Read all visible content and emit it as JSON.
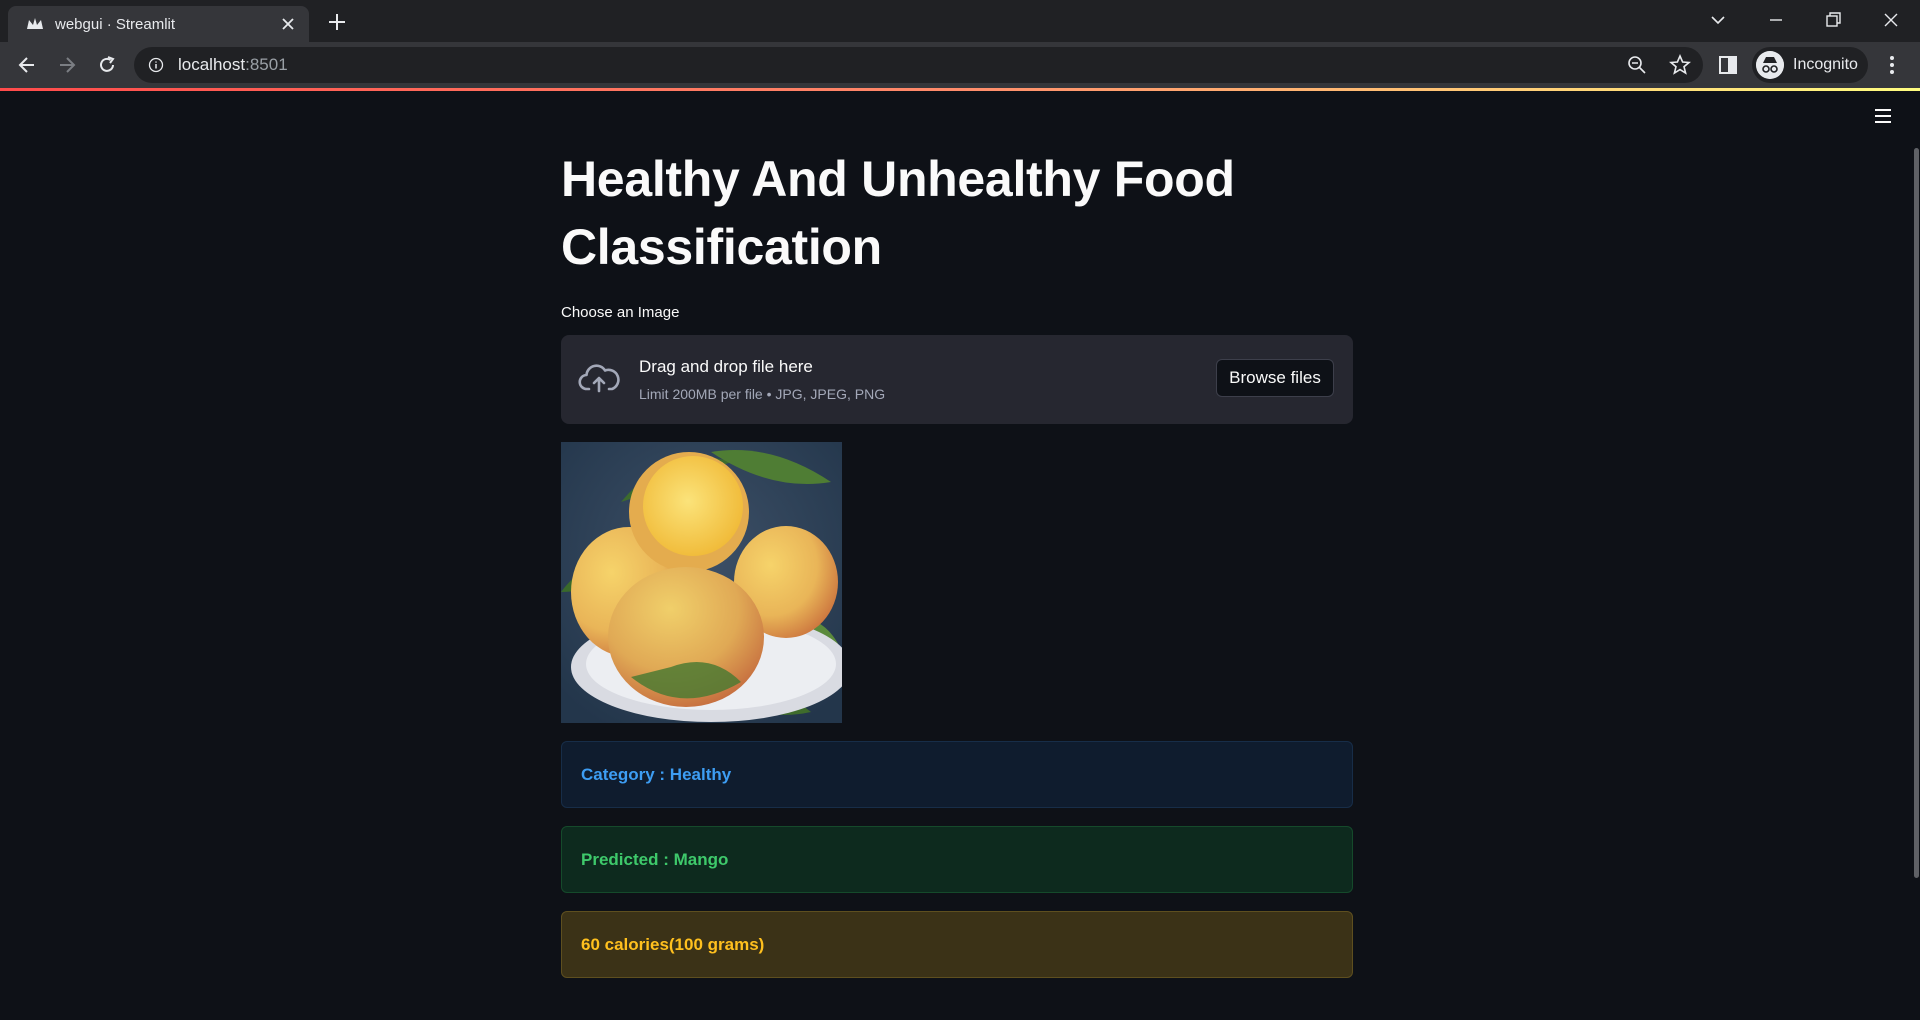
{
  "browser": {
    "tab": {
      "title": "webgui · Streamlit",
      "favicon": "streamlit-crown-icon"
    },
    "url_host": "localhost",
    "url_port": ":8501",
    "profile_label": "Incognito"
  },
  "page": {
    "title": "Healthy And Unhealthy Food Classification",
    "uploader": {
      "label": "Choose an Image",
      "drop_text": "Drag and drop file here",
      "limit_text": "Limit 200MB per file • JPG, JPEG, PNG",
      "browse_label": "Browse files",
      "icon": "cloud-upload-icon"
    },
    "image": {
      "subject": "mango-photo"
    },
    "results": {
      "category": "Category : Healthy",
      "predicted": "Predicted : Mango",
      "calories": "60 calories(100 grams)"
    }
  },
  "colors": {
    "background": "#0e1117",
    "info_text": "#3d9df3",
    "success_text": "#3ec96b",
    "warning_text": "#ffc01e"
  }
}
